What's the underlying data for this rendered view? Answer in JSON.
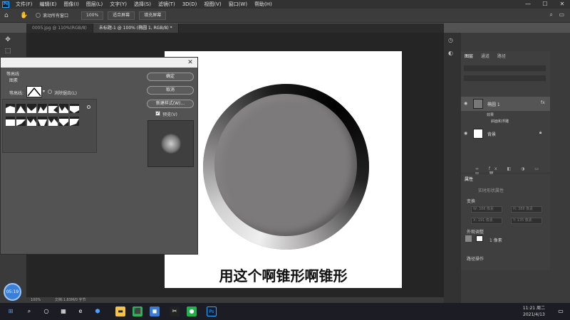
{
  "app": {
    "logo": "Ps",
    "menu": [
      "文件(F)",
      "编辑(E)",
      "图像(I)",
      "图层(L)",
      "文字(Y)",
      "选择(S)",
      "滤镜(T)",
      "3D(D)",
      "视图(V)",
      "窗口(W)",
      "帮助(H)"
    ],
    "window_controls": [
      "—",
      "☐",
      "✕"
    ]
  },
  "options_bar": {
    "scroll_all_label": "滚动所有窗口",
    "zoom_value": "100%",
    "fit_screen_label": "适合屏幕",
    "fill_screen_label": "填充屏幕"
  },
  "tabs": [
    {
      "label": "0005.jpg @ 110%(RGB/8)",
      "active": false
    },
    {
      "label": "未标题-1 @ 100% (椭圆 1, RGB/8) *",
      "active": true
    }
  ],
  "dialog": {
    "title": "",
    "section_label": "等高线",
    "sub_label": "图素",
    "contour_label": "等高线:",
    "antialias_label": "消除锯齿(L)",
    "ok_label": "确定",
    "cancel_label": "取消",
    "new_style_label": "新建样式(W)...",
    "preview_label": "预览(V)",
    "preview_checked": true
  },
  "canvas": {
    "caption": "用这个啊锥形啊锥形"
  },
  "layers_panel": {
    "tabs": [
      "图层",
      "通道",
      "路径"
    ],
    "layers": [
      {
        "name": "椭圆 1",
        "sub": [
          "效果",
          "斜面和浮雕"
        ]
      },
      {
        "name": "背景"
      }
    ]
  },
  "properties_panel": {
    "title": "属性",
    "subtitle": "实时形状属性",
    "section_transform": "变换",
    "fields": [
      "W: 388 像素",
      "H: 388 像素",
      "X: 191 像素",
      "Y: 135 像素"
    ],
    "section_appearance": "外观调整",
    "stroke_value": "1 像素",
    "section_path_ops": "路径操作"
  },
  "status_bar": {
    "zoom": "100%",
    "doc_info": "文档:1.83M/0 字节"
  },
  "timer": {
    "value": "05:19"
  },
  "taskbar": {
    "clock_time": "11:21 周二",
    "clock_date": "2021/4/13"
  }
}
